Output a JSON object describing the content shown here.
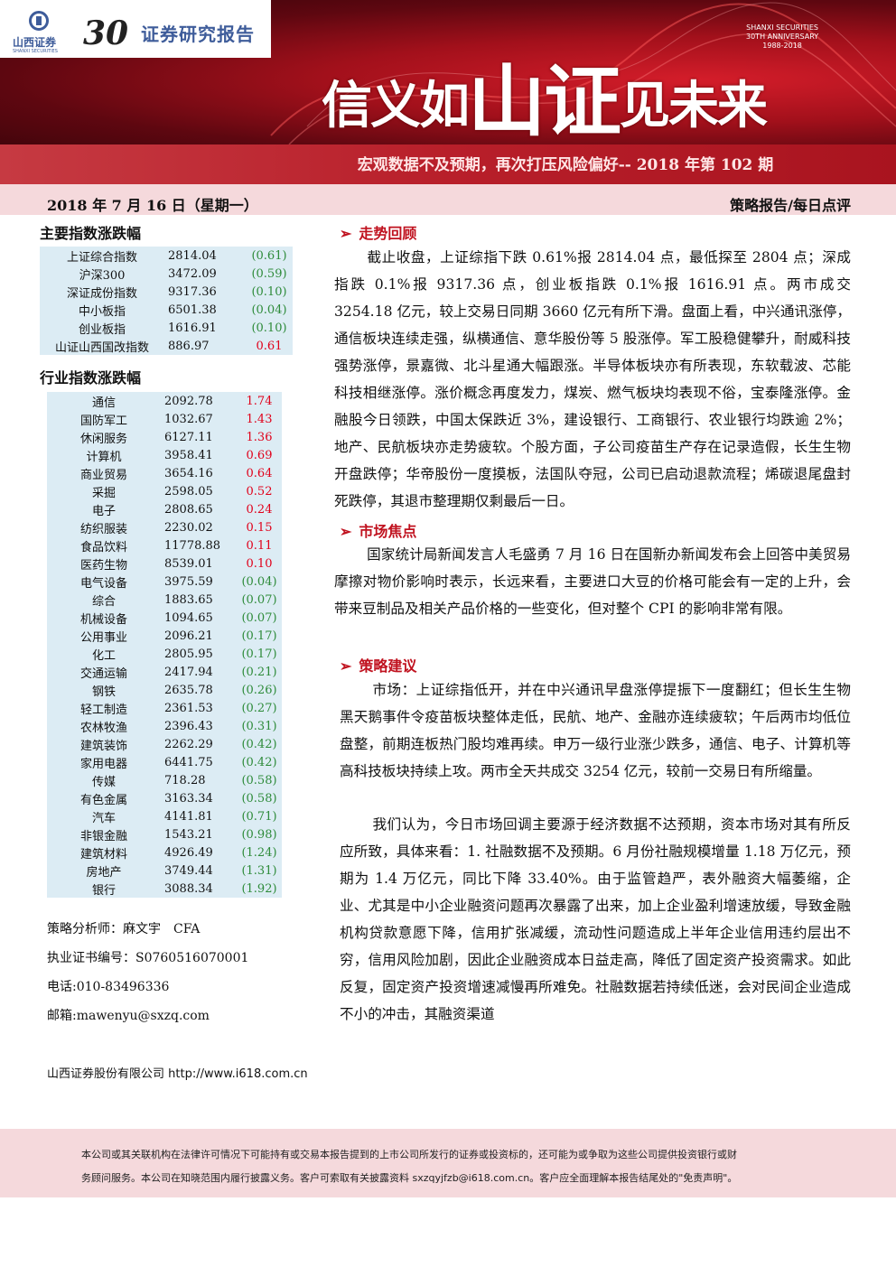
{
  "header": {
    "company_short": "山西证券",
    "company_en": "SHANXI SECURITIES",
    "anniversary_mark": "30",
    "report_label": "证券研究报告",
    "anniversary_badge": [
      "SHANXI SECURITIES",
      "30TH ANNIVERSARY",
      "1988-2018"
    ],
    "slogan_a": "信义如",
    "slogan_b": "山",
    "slogan_c": "证",
    "slogan_d": "见未来",
    "report_title": "宏观数据不及预期，再次打压风险偏好-- 2018 年第 102 期",
    "date": "2018 年 7 月 16 日（星期一）",
    "report_type": "策略报告/每日点评"
  },
  "main_index": {
    "title": "主要指数涨跌幅",
    "rows": [
      {
        "name": "上证综合指数",
        "value": "2814.04",
        "change": "(0.61)",
        "dir": "dn"
      },
      {
        "name": "沪深300",
        "value": "3472.09",
        "change": "(0.59)",
        "dir": "dn"
      },
      {
        "name": "深证成份指数",
        "value": "9317.36",
        "change": "(0.10)",
        "dir": "dn"
      },
      {
        "name": "中小板指",
        "value": "6501.38",
        "change": "(0.04)",
        "dir": "dn"
      },
      {
        "name": "创业板指",
        "value": "1616.91",
        "change": "(0.10)",
        "dir": "dn"
      },
      {
        "name": "山证山西国改指数",
        "value": "886.97",
        "change": "0.61",
        "dir": "up"
      }
    ]
  },
  "industry_index": {
    "title": "行业指数涨跌幅",
    "rows": [
      {
        "name": "通信",
        "value": "2092.78",
        "change": "1.74",
        "dir": "up"
      },
      {
        "name": "国防军工",
        "value": "1032.67",
        "change": "1.43",
        "dir": "up"
      },
      {
        "name": "休闲服务",
        "value": "6127.11",
        "change": "1.36",
        "dir": "up"
      },
      {
        "name": "计算机",
        "value": "3958.41",
        "change": "0.69",
        "dir": "up"
      },
      {
        "name": "商业贸易",
        "value": "3654.16",
        "change": "0.64",
        "dir": "up"
      },
      {
        "name": "采掘",
        "value": "2598.05",
        "change": "0.52",
        "dir": "up"
      },
      {
        "name": "电子",
        "value": "2808.65",
        "change": "0.24",
        "dir": "up"
      },
      {
        "name": "纺织服装",
        "value": "2230.02",
        "change": "0.15",
        "dir": "up"
      },
      {
        "name": "食品饮料",
        "value": "11778.88",
        "change": "0.11",
        "dir": "up"
      },
      {
        "name": "医药生物",
        "value": "8539.01",
        "change": "0.10",
        "dir": "up"
      },
      {
        "name": "电气设备",
        "value": "3975.59",
        "change": "(0.04)",
        "dir": "dn"
      },
      {
        "name": "综合",
        "value": "1883.65",
        "change": "(0.07)",
        "dir": "dn"
      },
      {
        "name": "机械设备",
        "value": "1094.65",
        "change": "(0.07)",
        "dir": "dn"
      },
      {
        "name": "公用事业",
        "value": "2096.21",
        "change": "(0.17)",
        "dir": "dn"
      },
      {
        "name": "化工",
        "value": "2805.95",
        "change": "(0.17)",
        "dir": "dn"
      },
      {
        "name": "交通运输",
        "value": "2417.94",
        "change": "(0.21)",
        "dir": "dn"
      },
      {
        "name": "钢铁",
        "value": "2635.78",
        "change": "(0.26)",
        "dir": "dn"
      },
      {
        "name": "轻工制造",
        "value": "2361.53",
        "change": "(0.27)",
        "dir": "dn"
      },
      {
        "name": "农林牧渔",
        "value": "2396.43",
        "change": "(0.31)",
        "dir": "dn"
      },
      {
        "name": "建筑装饰",
        "value": "2262.29",
        "change": "(0.42)",
        "dir": "dn"
      },
      {
        "name": "家用电器",
        "value": "6441.75",
        "change": "(0.42)",
        "dir": "dn"
      },
      {
        "name": "传媒",
        "value": "718.28",
        "change": "(0.58)",
        "dir": "dn"
      },
      {
        "name": "有色金属",
        "value": "3163.34",
        "change": "(0.58)",
        "dir": "dn"
      },
      {
        "name": "汽车",
        "value": "4141.81",
        "change": "(0.71)",
        "dir": "dn"
      },
      {
        "name": "非银金融",
        "value": "1543.21",
        "change": "(0.98)",
        "dir": "dn"
      },
      {
        "name": "建筑材料",
        "value": "4926.49",
        "change": "(1.24)",
        "dir": "dn"
      },
      {
        "name": "房地产",
        "value": "3749.44",
        "change": "(1.31)",
        "dir": "dn"
      },
      {
        "name": "银行",
        "value": "3088.34",
        "change": "(1.92)",
        "dir": "dn"
      }
    ]
  },
  "analyst": {
    "name_line": "策略分析师：麻文宇　CFA",
    "cert_line": "执业证书编号：S0760516070001",
    "phone_line": "电话:010-83496336",
    "email_line": "邮箱:mawenyu@sxzq.com"
  },
  "company_line": "山西证券股份有限公司 http://www.i618.com.cn",
  "sections": {
    "review_title": "走势回顾",
    "review_text": "截止收盘，上证综指下跌 0.61%报 2814.04 点，最低探至 2804 点；深成指跌 0.1%报 9317.36 点，创业板指跌 0.1%报 1616.91 点。两市成交 3254.18 亿元，较上交易日同期 3660 亿元有所下滑。盘面上看，中兴通讯涨停，通信板块连续走强，纵横通信、意华股份等 5 股涨停。军工股稳健攀升，耐威科技强势涨停，景嘉微、北斗星通大幅跟涨。半导体板块亦有所表现，东软载波、芯能科技相继涨停。涨价概念再度发力，煤炭、燃气板块均表现不俗，宝泰隆涨停。金融股今日领跌，中国太保跌近 3%，建设银行、工商银行、农业银行均跌逾 2%；地产、民航板块亦走势疲软。个股方面，子公司疫苗生产存在记录造假，长生生物开盘跌停；华帝股份一度摸板，法国队夺冠，公司已启动退款流程；烯碳退尾盘封死跌停，其退市整理期仅剩最后一日。",
    "focus_title": "市场焦点",
    "focus_text": "国家统计局新闻发言人毛盛勇 7 月 16 日在国新办新闻发布会上回答中美贸易摩擦对物价影响时表示，长远来看，主要进口大豆的价格可能会有一定的上升，会带来豆制品及相关产品价格的一些变化，但对整个 CPI 的影响非常有限。",
    "advice_title": "策略建议",
    "advice_text1": "市场：上证综指低开，并在中兴通讯早盘涨停提振下一度翻红；但长生生物黑天鹅事件令疫苗板块整体走低，民航、地产、金融亦连续疲软；午后两市均低位盘整，前期连板热门股均难再续。申万一级行业涨少跌多，通信、电子、计算机等高科技板块持续上攻。两市全天共成交 3254 亿元，较前一交易日有所缩量。",
    "advice_text2": "我们认为，今日市场回调主要源于经济数据不达预期，资本市场对其有所反应所致，具体来看：1. 社融数据不及预期。6 月份社融规模增量 1.18 万亿元，预期为 1.4 万亿元，同比下降 33.40%。由于监管趋严，表外融资大幅萎缩，企业、尤其是中小企业融资问题再次暴露了出来，加上企业盈利增速放缓，导致金融机构贷款意愿下降，信用扩张减缓，流动性问题造成上半年企业信用违约层出不穷，信用风险加剧，因此企业融资成本日益走高，降低了固定资产投资需求。如此反复，固定资产投资增速减慢再所难免。社融数据若持续低迷，会对民间企业造成不小的冲击，其融资渠道"
  },
  "disclaimer": {
    "line1": "本公司或其关联机构在法律许可情况下可能持有或交易本报告提到的上市公司所发行的证券或投资标的，还可能为或争取为这些公司提供投资银行或财",
    "line2": "务顾问服务。本公司在知晓范围内履行披露义务。客户可索取有关披露资料 sxzqyjfzb@i618.com.cn。客户应全面理解本报告结尾处的\"免责声明\"。"
  },
  "colors": {
    "up": "#e0001a",
    "down": "#2e8b3a",
    "brand_blue": "#3e5c9a",
    "brand_red": "#b81f2a"
  }
}
